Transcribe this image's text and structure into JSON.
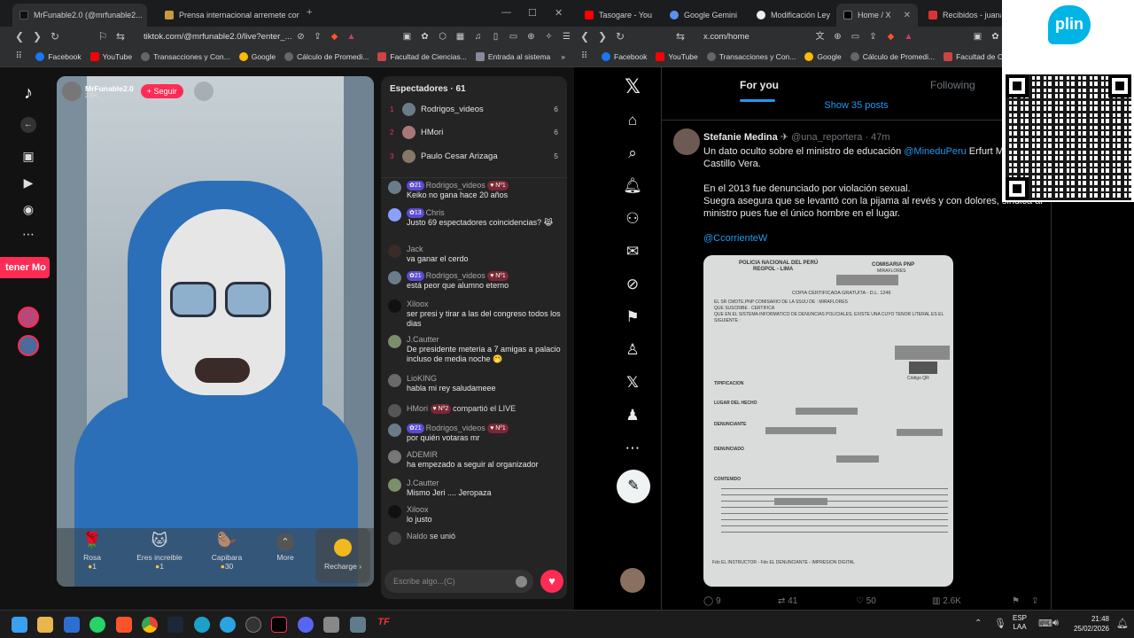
{
  "left_browser": {
    "tabs": [
      {
        "title": "MrFunable2.0 (@mrfunable2...",
        "active": true
      },
      {
        "title": "Prensa internacional arremete contra..."
      }
    ],
    "url": "tiktok.com/@mrfunable2.0/live?enter_...",
    "bookmarks": [
      "Facebook",
      "YouTube",
      "Transacciones y Con...",
      "Google",
      "Cálculo de Promedi...",
      "Facultad de Ciencias...",
      "Entrada al sistema"
    ],
    "bookmark_more": "»"
  },
  "tiktok": {
    "promo_text": "tener Mo",
    "host_name": "MrFunable2.0",
    "host_likes": "2.6K",
    "follow_label": "+ Seguir",
    "viewers_title": "Espectadores · 61",
    "top_viewers": [
      {
        "rank": "1",
        "name": "Rodrigos_videos",
        "count": "6"
      },
      {
        "rank": "2",
        "name": "HMori",
        "count": "6"
      },
      {
        "rank": "3",
        "name": "Paulo Cesar Arizaga",
        "count": "5"
      }
    ],
    "comments": [
      {
        "user": "Rodrigos_videos",
        "lvl": "21",
        "no": "Nº1",
        "text": "Keiko no gana hace 20 años"
      },
      {
        "user": "Chris",
        "lvl": "13",
        "no": "",
        "text": "Justo 69 espectadores coincidencias? 😹"
      },
      {
        "user": "Jack",
        "lvl": "",
        "no": "",
        "text": "va ganar el cerdo"
      },
      {
        "user": "Rodrigos_videos",
        "lvl": "21",
        "no": "Nº1",
        "text": "está peor que alumno eterno"
      },
      {
        "user": "Xiloox",
        "lvl": "",
        "no": "",
        "text": "ser presi y tirar a las del congreso todos los dias"
      },
      {
        "user": "J.Cautter",
        "lvl": "",
        "no": "",
        "text": "De presidente meteria a 7 amigas a palacio incluso de media noche 🤭"
      },
      {
        "user": "LioKING",
        "lvl": "",
        "no": "",
        "text": "habla mi rey saludameee"
      },
      {
        "user": "HMori",
        "lvl": "",
        "no": "Nº2",
        "text": "compartió el LIVE"
      },
      {
        "user": "Rodrigos_videos",
        "lvl": "21",
        "no": "Nº1",
        "text": "por quién votaras mr"
      },
      {
        "user": "ADEMIR",
        "lvl": "",
        "no": "",
        "text": "ha empezado a seguir al organizador"
      },
      {
        "user": "J.Cautter",
        "lvl": "",
        "no": "",
        "text": "Mismo Jeri .... Jeropaza"
      },
      {
        "user": "Xiloox",
        "lvl": "",
        "no": "",
        "text": "lo justo"
      },
      {
        "user": "Naldo",
        "lvl": "",
        "no": "",
        "text": "se unió"
      }
    ],
    "gifts": [
      {
        "name": "Rosa",
        "price": "1",
        "icon": "🌹"
      },
      {
        "name": "Eres increible",
        "price": "1",
        "icon": "🐱"
      },
      {
        "name": "Capibara",
        "price": "30",
        "icon": "🦫"
      },
      {
        "name": "More",
        "price": "",
        "icon": "⌃"
      }
    ],
    "recharge_label": "Recharge",
    "input_placeholder": "Escribe algo...(C)"
  },
  "right_browser": {
    "tabs": [
      "Tasogare - You",
      "Google Gemini",
      "Modificación Ley",
      "Home / X",
      "Recibidos - juana"
    ],
    "url": "x.com/home",
    "bookmarks": [
      "Facebook",
      "YouTube",
      "Transacciones y Con...",
      "Google",
      "Cálculo de Promedi...",
      "Facultad de Ciencias"
    ]
  },
  "x": {
    "tab_for_you": "For you",
    "tab_following": "Following",
    "show_posts": "Show 35 posts",
    "post": {
      "author": "Stefanie Medina",
      "handle": "@una_reportera",
      "time": "· 47m",
      "mention": "@MineduPeru",
      "text1": "Un dato oculto sobre el ministro de educación",
      "text1b": "Erfurt M",
      "text1c": "Castillo Vera.",
      "text2": "En el 2013 fue denunciado por violación sexual.",
      "text3": "Suegra asegura que se levantó con la pijama al revés y con dolores, sindica al ministro pues fue el único hombre en el lugar.",
      "link": "@CcorrienteW",
      "replies": "9",
      "reposts": "41",
      "likes": "50",
      "views": "2.6K"
    },
    "doc": {
      "h1": "POLICIA NACIONAL DEL PERÚ",
      "h2": "REGPOL - LIMA",
      "h3": "COMISARIA PNP",
      "h4": "MIRAFLORES",
      "copy": "COPIA CERTIFICADA GRATUITA - D.L. 1246",
      "l1": "EL SR CMDTE.PNP COMISARIO DE LA SSUU DE : MIRAFLORES",
      "l2": "QUE SUSCRIBE . CERTIFICA",
      "l3": "QUE EN EL SISTEMA INFORMATICO DE DENUNCIAS POLICIALES, EXISTE UNA CUYO TENOR LITERAL ES EL SIGUIENTE :",
      "tip": "TIPIFICACION",
      "lugar": "LUGAR DEL HECHO",
      "denunciante": "DENUNCIANTE",
      "denunciado": "DENUNCIADO",
      "contenido": "CONTENIDO",
      "firma": "Fdo EL INSTRUCTOR - Fdo EL DENUNCIANTE - IMPRESION DIGITAL",
      "codigo": "Código QR"
    }
  },
  "plin": {
    "logo": "plin"
  },
  "taskbar": {
    "lang1": "ESP",
    "lang2": "LAA",
    "time": "21:48",
    "date": "25/02/2026"
  },
  "colors": {
    "tiktok_pink": "#fe2c55",
    "x_blue": "#1d9bf0",
    "plin_blue": "#00b4e6"
  }
}
